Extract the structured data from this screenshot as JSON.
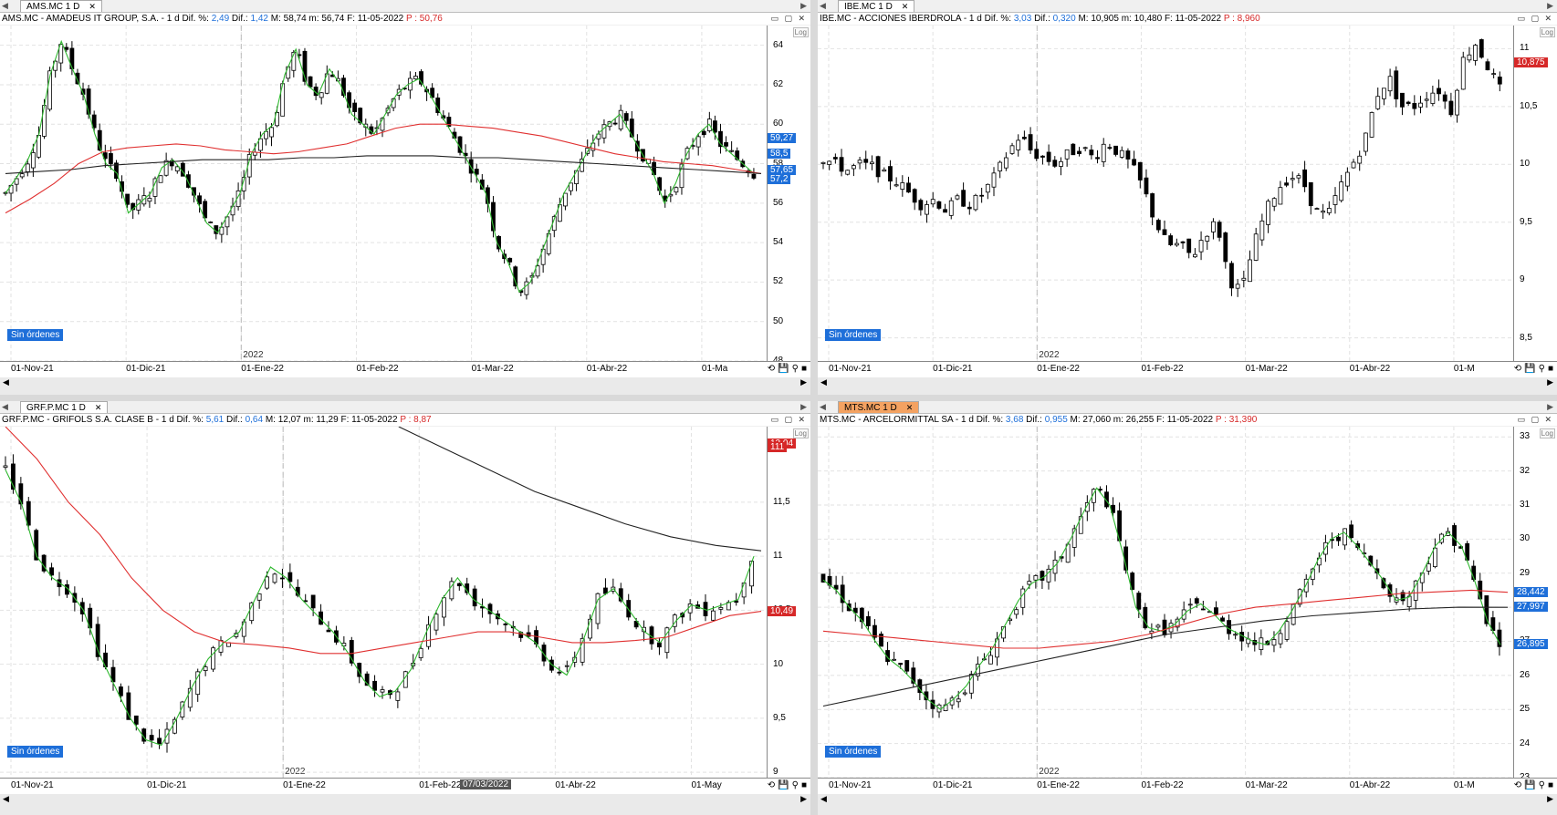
{
  "panes": [
    {
      "tab": {
        "label": "AMS.MC 1 D",
        "active": false
      },
      "info": {
        "prefix": "AMS.MC - AMADEUS IT GROUP, S.A. -  1 d  Dif. %: ",
        "pct": "2,49",
        "dif_label": "  Dif.: ",
        "dif": "1,42",
        "mid": "  M: 58,74  m: 56,74  F: 11-05-2022  ",
        "p": "P : 50,76"
      },
      "status": "Sin órdenes",
      "log": "Log",
      "year_marker": "2022",
      "x_labels": [
        "01-Nov-21",
        "01-Dic-21",
        "01-Ene-22",
        "01-Feb-22",
        "01-Mar-22",
        "01-Abr-22",
        "01-Ma"
      ],
      "y_ticks": [
        "64",
        "62",
        "60",
        "58",
        "56",
        "54",
        "52",
        "50",
        "48"
      ],
      "y_tags": [
        {
          "text": "59,27",
          "color": "#1e6fd9"
        },
        {
          "text": "58,5",
          "color": "#1e6fd9"
        },
        {
          "text": "57,65",
          "color": "#1e6fd9"
        },
        {
          "text": "57,2",
          "color": "#1e6fd9"
        }
      ]
    },
    {
      "tab": {
        "label": "IBE.MC 1 D",
        "active": false
      },
      "info": {
        "prefix": "IBE.MC - ACCIONES IBERDROLA -  1 d  Dif. %: ",
        "pct": "3,03",
        "dif_label": "  Dif.: ",
        "dif": "0,320",
        "mid": "  M: 10,905  m: 10,480  F: 11-05-2022  ",
        "p": "P : 8,960"
      },
      "status": "Sin órdenes",
      "log": "Log",
      "year_marker": "2022",
      "x_labels": [
        "01-Nov-21",
        "01-Dic-21",
        "01-Ene-22",
        "01-Feb-22",
        "01-Mar-22",
        "01-Abr-22",
        "01-M"
      ],
      "y_ticks": [
        "11",
        "10,5",
        "10",
        "9,5",
        "9",
        "8,5"
      ],
      "y_tags": [
        {
          "text": "10,875",
          "color": "#d62828"
        }
      ]
    },
    {
      "tab": {
        "label": "GRF.P.MC 1 D",
        "active": false
      },
      "info": {
        "prefix": "GRF.P.MC - GRIFOLS S.A. CLASE B -  1 d  Dif. %: ",
        "pct": "5,61",
        "dif_label": "  Dif.: ",
        "dif": "0,64",
        "mid": "  M: 12,07  m: 11,29  F: 11-05-2022  ",
        "p": "P : 8,87"
      },
      "status": "Sin órdenes",
      "log": "Log",
      "year_marker": "2022",
      "cursor_date": "07/03/2022",
      "x_labels": [
        "01-Nov-21",
        "01-Dic-21",
        "01-Ene-22",
        "01-Feb-22",
        "01-Abr-22",
        "01-May"
      ],
      "y_ticks": [
        "11,5",
        "11",
        "10,5",
        "10",
        "9,5",
        "9"
      ],
      "y_tags": [
        {
          "text": "12,04",
          "color": "#d62828"
        },
        {
          "text": "111",
          "color": "#d62828"
        },
        {
          "text": "10,49",
          "color": "#d62828"
        }
      ]
    },
    {
      "tab": {
        "label": "MTS.MC 1 D",
        "active": true
      },
      "info": {
        "prefix": "MTS.MC - ARCELORMITTAL SA -  1 d  Dif. %: ",
        "pct": "3,68",
        "dif_label": "  Dif.: ",
        "dif": "0,955",
        "mid": "  M: 27,060  m: 26,255  F: 11-05-2022  ",
        "p": "P : 31,390"
      },
      "status": "Sin órdenes",
      "log": "Log",
      "year_marker": "2022",
      "x_labels": [
        "01-Nov-21",
        "01-Dic-21",
        "01-Ene-22",
        "01-Feb-22",
        "01-Mar-22",
        "01-Abr-22",
        "01-M"
      ],
      "y_ticks": [
        "33",
        "32",
        "31",
        "30",
        "29",
        "28",
        "27",
        "26",
        "25",
        "24",
        "23"
      ],
      "y_tags": [
        {
          "text": "28,442",
          "color": "#1e6fd9"
        },
        {
          "text": "27,997",
          "color": "#1e6fd9"
        },
        {
          "text": "26,895",
          "color": "#1e6fd9"
        }
      ]
    }
  ],
  "colors": {
    "up": "#ffffff",
    "down": "#000000",
    "ma_fast": "#2fb82f",
    "ma_mid": "#e03030",
    "ma_slow": "#222222",
    "tag_blue": "#1e6fd9",
    "tag_red": "#d62828"
  },
  "chart_data": [
    {
      "type": "line",
      "title": "AMS.MC - AMADEUS IT GROUP, S.A.",
      "ylim": [
        48,
        65
      ],
      "series": [
        {
          "values": [
            56.5,
            57.3,
            58.2,
            59.5,
            62.5,
            64.2,
            62.8,
            61.5,
            59.5,
            58,
            57.5,
            55.5,
            56,
            56.5,
            57.8,
            58.2,
            57.5,
            56.3,
            55,
            54.5,
            55.5,
            56.5,
            58.5,
            59.5,
            60,
            62.5,
            63.8,
            62,
            61.5,
            62.8,
            62,
            60.5,
            60,
            59.5,
            60.5,
            61.5,
            62,
            62.3,
            61.5,
            60.5,
            59.5,
            58.5,
            57.5,
            56.5,
            54,
            53,
            51.5,
            52,
            53.5,
            55,
            56.5,
            57.5,
            58.5,
            59.5,
            60,
            60.5,
            59.5,
            58.5,
            57.5,
            56,
            57,
            58.5,
            59.5,
            60,
            59,
            58.5,
            58,
            57.5
          ]
        },
        {
          "values": [
            55.5,
            56.2,
            57,
            58,
            58.6,
            58.8,
            58.9,
            59,
            58.9,
            58.7,
            58.6,
            58.5,
            58.6,
            58.8,
            59,
            59.4,
            59.8,
            60,
            60,
            59.9,
            59.8,
            59.6,
            59.4,
            59.1,
            58.8,
            58.5,
            58.3,
            58.1,
            58,
            57.9,
            57.7,
            57.5
          ]
        },
        {
          "values": [
            57.5,
            57.6,
            57.7,
            57.9,
            58,
            58.1,
            58.2,
            58.2,
            58.2,
            58.3,
            58.3,
            58.4,
            58.4,
            58.4,
            58.3,
            58.3,
            58.2,
            58.1,
            58.0,
            57.9,
            57.8,
            57.7,
            57.6,
            57.5
          ]
        }
      ]
    },
    {
      "type": "line",
      "title": "IBE.MC - ACCIONES IBERDROLA",
      "ylim": [
        8.3,
        11.2
      ],
      "series": [
        {
          "values": [
            10.05,
            10.0,
            9.95,
            10.0,
            9.98,
            9.9,
            9.85,
            9.75,
            9.65,
            9.7,
            9.6,
            9.7,
            9.65,
            9.75,
            9.9,
            10.1,
            10.25,
            10.1,
            10.05,
            10.0,
            10.1,
            10.15,
            10.05,
            10.2,
            10.1,
            10.0,
            9.8,
            9.5,
            9.3,
            9.3,
            9.2,
            9.4,
            9.5,
            9.0,
            8.9,
            9.3,
            9.6,
            9.8,
            9.9,
            9.85,
            9.6,
            9.55,
            9.8,
            10.0,
            10.2,
            10.6,
            10.75,
            10.5,
            10.5,
            10.6,
            10.65,
            10.45,
            10.9,
            11.05,
            10.85,
            10.65
          ]
        }
      ]
    },
    {
      "type": "line",
      "title": "GRF.P.MC - GRIFOLS S.A. CLASE B",
      "ylim": [
        8.95,
        12.2
      ],
      "series": [
        {
          "values": [
            11.8,
            11.5,
            11.0,
            10.8,
            10.7,
            10.5,
            10.1,
            9.8,
            9.5,
            9.3,
            9.25,
            9.5,
            9.8,
            10.05,
            10.2,
            10.3,
            10.6,
            10.9,
            10.8,
            10.6,
            10.45,
            10.3,
            10.1,
            9.85,
            9.7,
            9.75,
            9.95,
            10.3,
            10.6,
            10.8,
            10.6,
            10.5,
            10.4,
            10.3,
            10.2,
            10.0,
            9.9,
            10.2,
            10.6,
            10.7,
            10.5,
            10.3,
            10.2,
            10.4,
            10.55,
            10.5,
            10.55,
            10.6,
            11.0
          ]
        },
        {
          "values": [
            12.2,
            11.9,
            11.5,
            11.2,
            10.8,
            10.5,
            10.3,
            10.2,
            10.18,
            10.15,
            10.1,
            10.1,
            10.15,
            10.2,
            10.25,
            10.3,
            10.3,
            10.25,
            10.2,
            10.2,
            10.22,
            10.25,
            10.35,
            10.45,
            10.49
          ]
        },
        {
          "values": [
            12.2,
            12.0,
            11.8,
            11.6,
            11.45,
            11.3,
            11.18,
            11.1,
            11.05
          ]
        }
      ]
    },
    {
      "type": "line",
      "title": "MTS.MC - ARCELORMITTAL SA",
      "ylim": [
        23,
        33.3
      ],
      "series": [
        {
          "values": [
            28.8,
            28.5,
            28.0,
            27.6,
            27.0,
            26.5,
            26.2,
            25.8,
            25.3,
            25.0,
            25.3,
            25.7,
            26.3,
            26.8,
            27.5,
            28.2,
            28.7,
            28.9,
            29.3,
            30.0,
            30.8,
            31.5,
            31.0,
            29.6,
            28.0,
            27.4,
            27.3,
            27.5,
            27.9,
            28.1,
            27.8,
            27.4,
            27.2,
            27.0,
            26.9,
            27.3,
            27.9,
            28.6,
            29.4,
            30.0,
            30.2,
            29.8,
            29.3,
            28.8,
            28.2,
            28.3,
            29.0,
            29.8,
            30.2,
            29.8,
            28.8,
            27.6,
            26.895
          ]
        },
        {
          "values": [
            27.3,
            27.2,
            27.1,
            27.0,
            26.9,
            26.8,
            26.8,
            26.9,
            27.0,
            27.2,
            27.5,
            27.8,
            28.0,
            28.1,
            28.2,
            28.3,
            28.4,
            28.45,
            28.5,
            28.44
          ]
        },
        {
          "values": [
            25.1,
            25.4,
            25.7,
            26.0,
            26.3,
            26.6,
            26.9,
            27.2,
            27.4,
            27.6,
            27.75,
            27.85,
            27.95,
            28.0,
            27.997
          ]
        }
      ]
    }
  ]
}
